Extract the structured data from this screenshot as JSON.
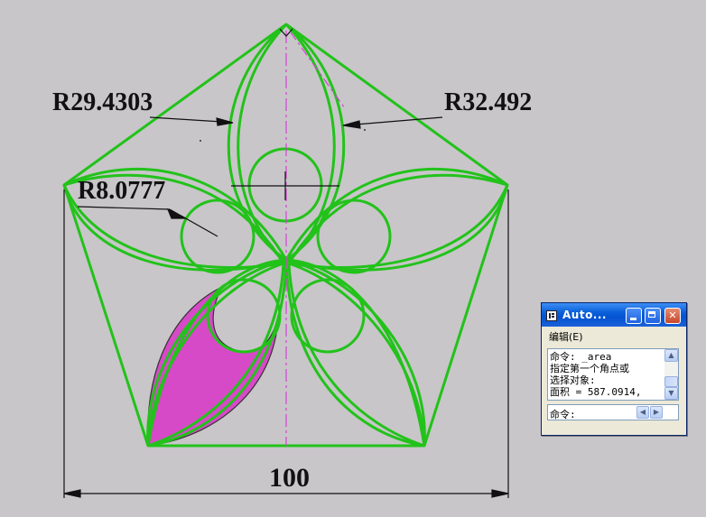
{
  "drawing": {
    "colors": {
      "background": "#c8c6c9",
      "geometry": "#22c21a",
      "centerline": "#d642d4",
      "fill": "#d64ac8",
      "dimension": "#111111"
    },
    "dimensions": {
      "radius_left": "R29.4303",
      "radius_right": "R32.492",
      "radius_small": "R8.0777",
      "width": "100"
    }
  },
  "text_window": {
    "title": "Auto...",
    "menu": {
      "edit_label": "编辑(E)"
    },
    "history": [
      "命令: _area",
      "指定第一个角点或",
      "选择对象:",
      "面积 = 587.0914,"
    ],
    "prompt": "命令:",
    "icons": {
      "app": "autocad-text-window-icon",
      "minimize": "minimize-icon",
      "maximize": "maximize-icon",
      "close": "close-icon",
      "scroll_up": "arrow-up-icon",
      "scroll_down": "arrow-down-icon",
      "scroll_left": "arrow-left-icon",
      "scroll_right": "arrow-right-icon"
    }
  }
}
